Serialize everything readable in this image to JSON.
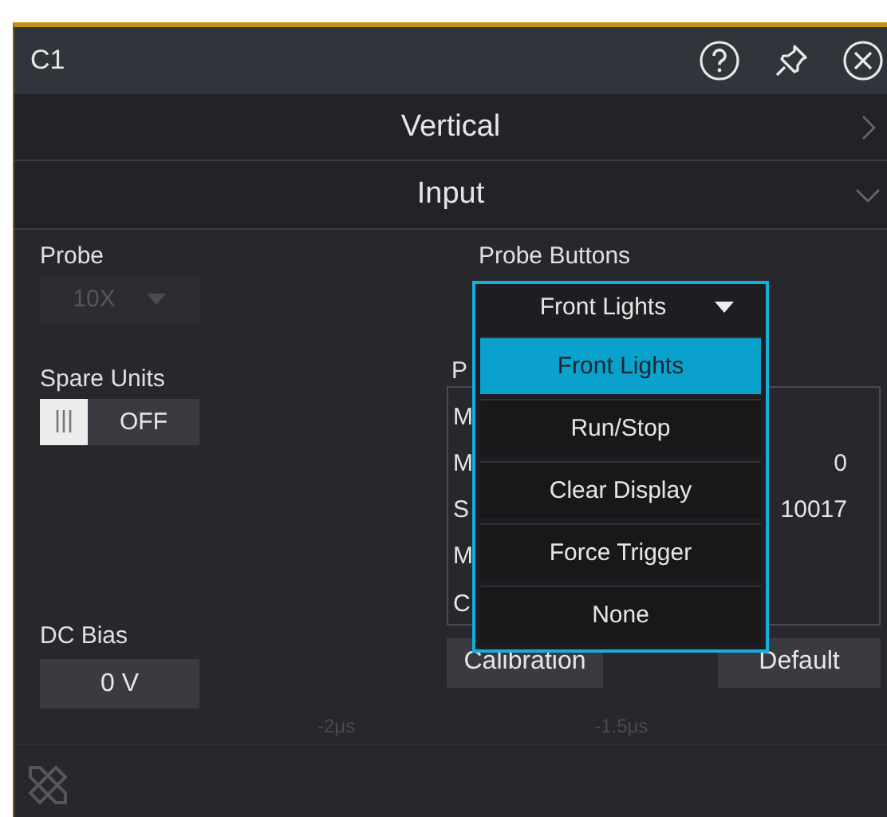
{
  "window": {
    "title": "C1"
  },
  "sections": [
    {
      "label": "Vertical",
      "expanded": false
    },
    {
      "label": "Input",
      "expanded": true
    }
  ],
  "probe": {
    "label": "Probe",
    "value": "10X",
    "disabled": true
  },
  "spare_units": {
    "label": "Spare Units",
    "on": false,
    "state_text": "OFF"
  },
  "dc_bias": {
    "label": "DC Bias",
    "value": "0 V"
  },
  "probe_buttons": {
    "label": "Probe Buttons",
    "value": "Front Lights",
    "expanded": true,
    "options": [
      {
        "label": "Front Lights",
        "selected": true
      },
      {
        "label": "Run/Stop",
        "selected": false
      },
      {
        "label": "Clear Display",
        "selected": false
      },
      {
        "label": "Force Trigger",
        "selected": false
      },
      {
        "label": "None",
        "selected": false
      }
    ]
  },
  "probe_info": {
    "label": "P",
    "rows": [
      {
        "name": "M"
      },
      {
        "name": "M",
        "value": "0"
      },
      {
        "name": "S",
        "value": "10017"
      },
      {
        "name": "M"
      },
      {
        "name": "C"
      }
    ]
  },
  "buttons": [
    "Calibration",
    "Default"
  ],
  "background_axis": [
    "-2μs",
    "-1.5μs"
  ]
}
